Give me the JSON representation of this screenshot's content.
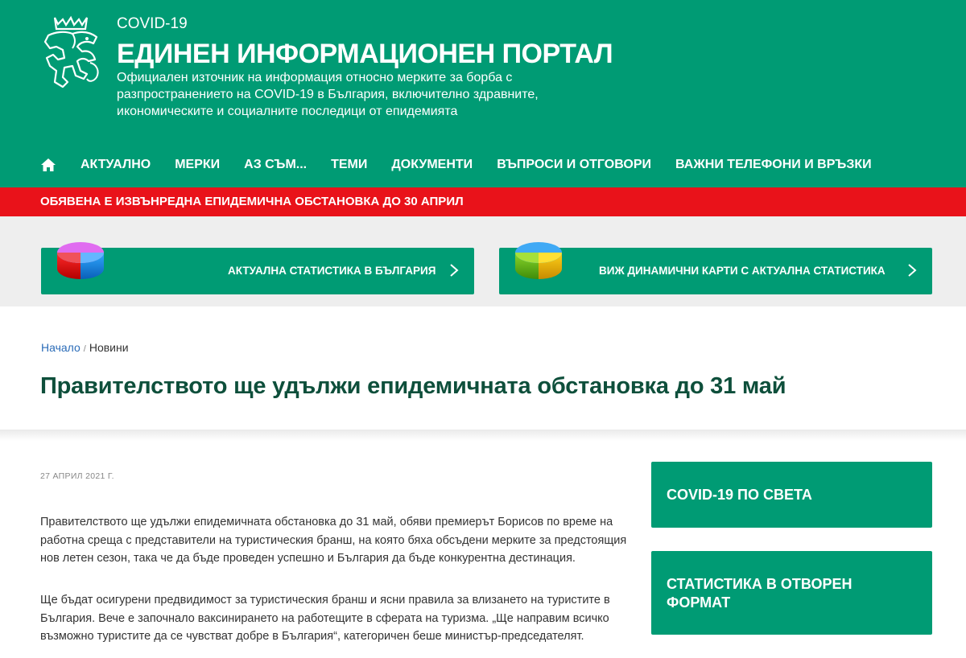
{
  "header": {
    "covid_label": "COVID-19",
    "title": "ЕДИНЕН ИНФОРМАЦИОНЕН ПОРТАЛ",
    "description": "Официален източник на информация относно мерките за борба с разпространението на COVID-19 в България, включително здравните, икономическите и социалните последици от епидемията",
    "logo_icon": "lion-coat-of-arms-icon"
  },
  "nav": {
    "home_icon": "home-icon",
    "items": [
      "АКТУАЛНО",
      "МЕРКИ",
      "АЗ СЪМ...",
      "ТЕМИ",
      "ДОКУМЕНТИ",
      "ВЪПРОСИ И ОТГОВОРИ",
      "ВАЖНИ ТЕЛЕФОНИ И ВРЪЗКИ"
    ]
  },
  "alert": {
    "text": "ОБЯВЕНА Е ИЗВЪНРЕДНА ЕПИДЕМИЧНА ОБСТАНОВКА ДО 30 АПРИЛ"
  },
  "stats": {
    "bg_stats_label": "АКТУАЛНА СТАТИСТИКА В БЪЛГАРИЯ",
    "maps_label": "ВИЖ ДИНАМИЧНИ КАРТИ С АКТУАЛНА СТАТИСТИКА"
  },
  "breadcrumb": {
    "home": "Начало",
    "separator": "/",
    "current": "Новини"
  },
  "article": {
    "title": "Правителството ще удължи епидемичната обстановка до 31 май",
    "date": "27 АПРИЛ 2021 Г.",
    "paragraphs": [
      "Правителството ще удължи епидемичната обстановка до 31 май, обяви премиерът Борисов по време на работна среща с представители на туристическия бранш, на която бяха обсъдени мерките за предстоящия нов летен сезон, така че да бъде проведен успешно и България да бъде конкурентна дестинация.",
      "Ще бъдат осигурени предвидимост  за туристическия бранш и ясни правила за влизането на туристите в България. Вече е започнало ваксинирането на работещите в сферата на туризма.  „Ще направим всичко възможно  туристите да се чувстват добре в България“, категоричен беше министър-председателят."
    ]
  },
  "sidebar": {
    "cards": [
      "COVID-19 ПО СВЕТА",
      "СТАТИСТИКА В ОТВОРЕН ФОРМАТ"
    ]
  },
  "colors": {
    "primary_green": "#009b74",
    "alert_red": "#e9121a",
    "title_dark_green": "#0e4f3b",
    "link_blue": "#2b6cb8"
  }
}
